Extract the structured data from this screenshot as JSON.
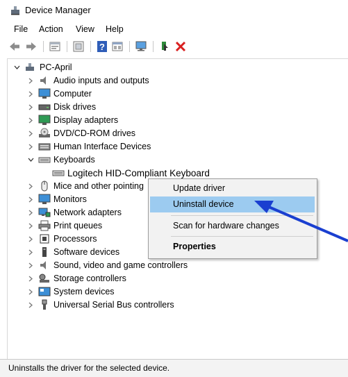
{
  "window": {
    "title": "Device Manager"
  },
  "menu": {
    "items": [
      "File",
      "Action",
      "View",
      "Help"
    ]
  },
  "toolbar": {
    "buttons": [
      "back-icon",
      "forward-icon",
      "properties-icon",
      "refresh-icon",
      "help-icon",
      "details-icon",
      "monitor-icon",
      "update-driver-icon",
      "uninstall-icon"
    ]
  },
  "tree": {
    "root": "PC-April",
    "items": [
      "Audio inputs and outputs",
      "Computer",
      "Disk drives",
      "Display adapters",
      "DVD/CD-ROM drives",
      "Human Interface Devices",
      "Keyboards",
      "Logitech HID-Compliant Keyboard",
      "Mice and other pointing",
      "Monitors",
      "Network adapters",
      "Print queues",
      "Processors",
      "Software devices",
      "Sound, video and game controllers",
      "Storage controllers",
      "System devices",
      "Universal Serial Bus controllers"
    ]
  },
  "context_menu": {
    "update": "Update driver",
    "uninstall": "Uninstall device",
    "scan": "Scan for hardware changes",
    "properties": "Properties"
  },
  "status": {
    "text": "Uninstalls the driver for the selected device."
  },
  "colors": {
    "highlight": "#9ccbf0",
    "arrow": "#1a3fd0",
    "uninstall": "#d91f1f"
  }
}
